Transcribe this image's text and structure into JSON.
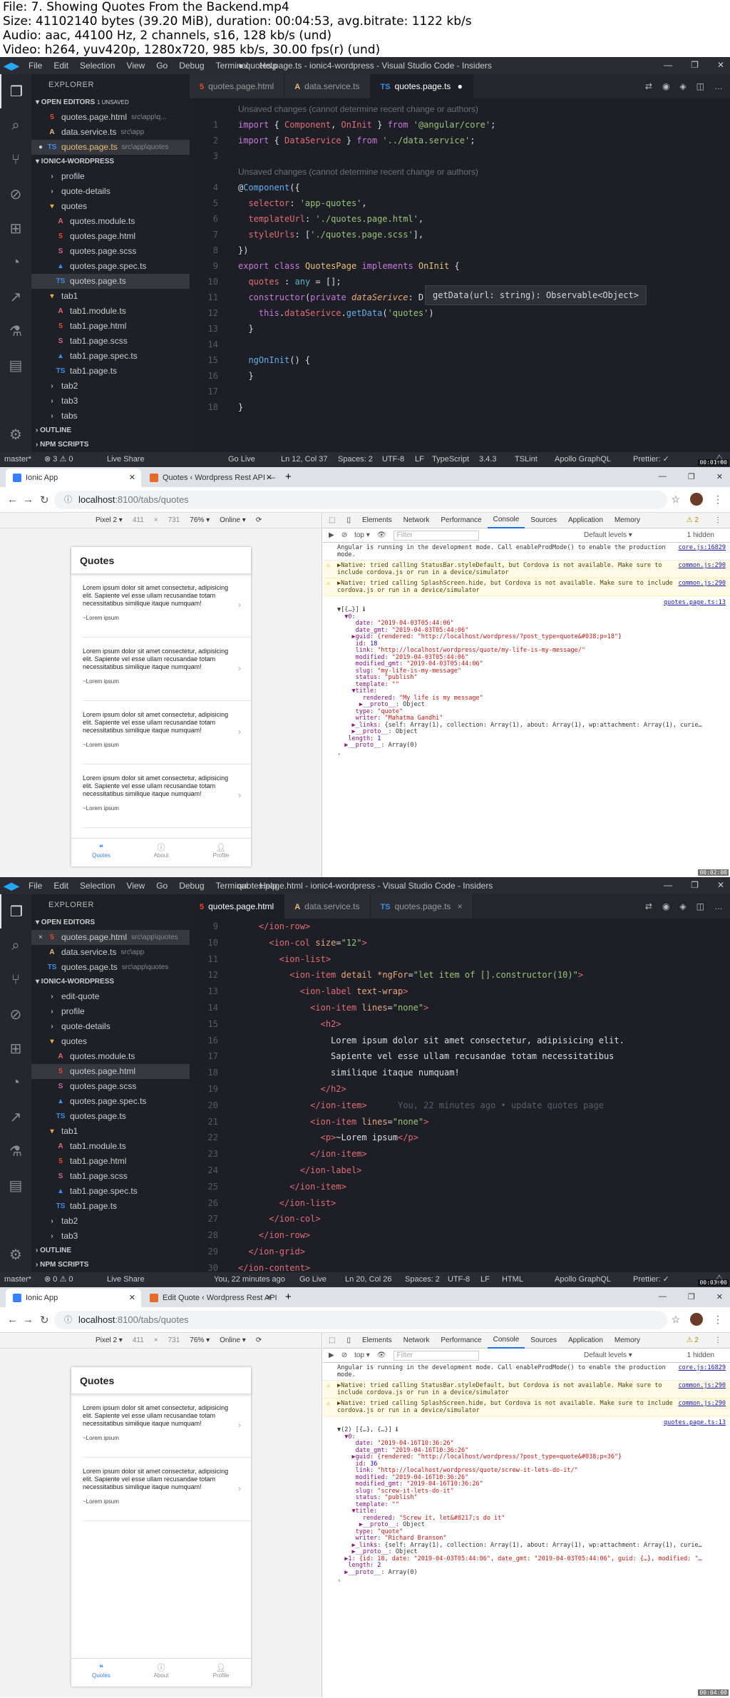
{
  "header": {
    "lines": [
      "File: 7. Showing Quotes From the Backend.mp4",
      "Size: 41102140 bytes (39.20 MiB), duration: 00:04:53, avg.bitrate: 1122 kb/s",
      "Audio: aac, 44100 Hz, 2 channels, s16, 128 kb/s (und)",
      "Video: h264, yuv420p, 1280x720, 985 kb/s, 30.00 fps(r) (und)"
    ]
  },
  "timestamps": [
    "00:01:00",
    "00:02:00",
    "00:03:00",
    "00:04:00"
  ],
  "vscode": {
    "menu": [
      "File",
      "Edit",
      "Selection",
      "View",
      "Go",
      "Debug",
      "Terminal",
      "Help"
    ],
    "explorer_title": "EXPLORER",
    "open_editors": "OPEN EDITORS",
    "unsaved": "1 UNSAVED",
    "project": "IONIC4-WORDPRESS",
    "outline": "OUTLINE",
    "npm_scripts": "NPM SCRIPTS",
    "frame1": {
      "window_title": "● quotes.page.ts - ionic4-wordpress - Visual Studio Code - Insiders",
      "tabs": [
        {
          "icon": "html-icon",
          "glyph": "5",
          "color": "#e44d26",
          "label": "quotes.page.html",
          "extra": ""
        },
        {
          "icon": "angular-icon",
          "glyph": "A",
          "color": "#e5c07b",
          "label": "data.service.ts",
          "extra": ""
        },
        {
          "icon": "ts-icon",
          "glyph": "TS",
          "color": "#3a8ee6",
          "label": "quotes.page.ts",
          "extra": "●"
        }
      ],
      "open_editors": [
        {
          "icon": "html-icon",
          "glyph": "5",
          "color": "#e44d26",
          "label": "quotes.page.html",
          "path": "src\\app\\q...",
          "mark": ""
        },
        {
          "icon": "angular-icon",
          "glyph": "A",
          "color": "#e5c07b",
          "label": "data.service.ts",
          "path": "src\\app",
          "mark": ""
        },
        {
          "icon": "ts-icon",
          "glyph": "TS",
          "color": "#3a8ee6",
          "label": "quotes.page.ts",
          "path": "src\\app\\quotes",
          "mark": "●"
        }
      ],
      "tree": [
        {
          "indent": 1,
          "icon": "chevron",
          "glyph": "›",
          "color": "#bbb",
          "label": "profile"
        },
        {
          "indent": 1,
          "icon": "chevron",
          "glyph": "›",
          "color": "#bbb",
          "label": "quote-details"
        },
        {
          "indent": 1,
          "icon": "folder-open",
          "glyph": "▾",
          "color": "#e8b04a",
          "label": "quotes"
        },
        {
          "indent": 2,
          "icon": "angular-icon",
          "glyph": "A",
          "color": "#e06c75",
          "label": "quotes.module.ts"
        },
        {
          "indent": 2,
          "icon": "html-icon",
          "glyph": "5",
          "color": "#e44d26",
          "label": "quotes.page.html"
        },
        {
          "indent": 2,
          "icon": "scss-icon",
          "glyph": "S",
          "color": "#cd6799",
          "label": "quotes.page.scss"
        },
        {
          "indent": 2,
          "icon": "spec-icon",
          "glyph": "▲",
          "color": "#3a8ee6",
          "label": "quotes.page.spec.ts"
        },
        {
          "indent": 2,
          "icon": "ts-icon",
          "glyph": "TS",
          "color": "#3a8ee6",
          "label": "quotes.page.ts",
          "sel": true
        },
        {
          "indent": 1,
          "icon": "folder-open",
          "glyph": "▾",
          "color": "#e8b04a",
          "label": "tab1"
        },
        {
          "indent": 2,
          "icon": "angular-icon",
          "glyph": "A",
          "color": "#e06c75",
          "label": "tab1.module.ts"
        },
        {
          "indent": 2,
          "icon": "html-icon",
          "glyph": "5",
          "color": "#e44d26",
          "label": "tab1.page.html"
        },
        {
          "indent": 2,
          "icon": "scss-icon",
          "glyph": "S",
          "color": "#cd6799",
          "label": "tab1.page.scss"
        },
        {
          "indent": 2,
          "icon": "spec-icon",
          "glyph": "▲",
          "color": "#3a8ee6",
          "label": "tab1.page.spec.ts"
        },
        {
          "indent": 2,
          "icon": "ts-icon",
          "glyph": "TS",
          "color": "#3a8ee6",
          "label": "tab1.page.ts"
        },
        {
          "indent": 1,
          "icon": "chevron",
          "glyph": "›",
          "color": "#bbb",
          "label": "tab2"
        },
        {
          "indent": 1,
          "icon": "chevron",
          "glyph": "›",
          "color": "#bbb",
          "label": "tab3"
        },
        {
          "indent": 1,
          "icon": "chevron",
          "glyph": "›",
          "color": "#bbb",
          "label": "tabs"
        }
      ],
      "lens_top": "Unsaved changes (cannot determine recent change or authors)",
      "lens_mid": "Unsaved changes (cannot determine recent change or authors)",
      "lines": [
        {
          "n": "1",
          "html": "<span class=\"k\">import</span> <span class=\"w\">{ </span><span class=\"c\">Component</span><span class=\"w\">, </span><span class=\"c\">OnInit</span><span class=\"w\"> } </span><span class=\"k\">from</span> <span class=\"g\">'@angular/core'</span><span class=\"w\">;</span>"
        },
        {
          "n": "2",
          "html": "<span class=\"k\">import</span> <span class=\"w\">{ </span><span class=\"c\">DataService</span><span class=\"w\"> } </span><span class=\"k\">from</span> <span class=\"g\">'../data.service'</span><span class=\"w\">;</span>"
        },
        {
          "n": "3",
          "html": ""
        },
        {
          "n": "4",
          "html": "<span class=\"w\">@</span><span class=\"b\">Component</span><span class=\"w\">({</span>"
        },
        {
          "n": "5",
          "html": "  <span class=\"c\">selector</span><span class=\"w\">: </span><span class=\"g\">'app-quotes'</span><span class=\"w\">,</span>"
        },
        {
          "n": "6",
          "html": "  <span class=\"c\">templateUrl</span><span class=\"w\">: </span><span class=\"g\">'./quotes.page.html'</span><span class=\"w\">,</span>"
        },
        {
          "n": "7",
          "html": "  <span class=\"c\">styleUrls</span><span class=\"w\">: [</span><span class=\"g\">'./quotes.page.scss'</span><span class=\"w\">],</span>"
        },
        {
          "n": "8",
          "html": "<span class=\"w\">})</span>"
        },
        {
          "n": "9",
          "html": "<span class=\"k\">export</span> <span class=\"k\">class</span> <span class=\"y\">QuotesPage</span> <span class=\"k\">implements</span> <span class=\"y\">OnInit</span> <span class=\"w\">{</span>"
        },
        {
          "n": "10",
          "html": "  <span class=\"c\">quotes</span> <span class=\"w\">: </span><span class=\"t\">any</span> <span class=\"w\">= [];</span>"
        },
        {
          "n": "11",
          "html": "  <span class=\"k\">constructor</span><span class=\"w\">(</span><span class=\"k\">private</span> <span class=\"o\"><i>dataSerivce</i></span><span class=\"w\">: D</span>"
        },
        {
          "n": "12",
          "html": "    <span class=\"k\">this</span><span class=\"w\">.</span><span class=\"c\">dataSerivce</span><span class=\"w\">.</span><span class=\"b\">getData</span><span class=\"w\">(</span><span class=\"g\">'quotes'</span><span class=\"w\">)</span>"
        },
        {
          "n": "13",
          "html": "  <span class=\"w\">}</span>"
        },
        {
          "n": "14",
          "html": ""
        },
        {
          "n": "15",
          "html": "  <span class=\"b\">ngOnInit</span><span class=\"w\">() {</span>"
        },
        {
          "n": "16",
          "html": "  <span class=\"w\">}</span>"
        },
        {
          "n": "17",
          "html": ""
        },
        {
          "n": "18",
          "html": "<span class=\"w\">}</span>"
        }
      ],
      "hover": "getData(url: string): Observable<Object>",
      "status": {
        "branch": "master*",
        "errors": "⊗ 3 ⚠ 0",
        "live_share": "Live Share",
        "go_live": "Go Live",
        "position": "Ln 12, Col 37",
        "spaces": "Spaces: 2",
        "encoding": "UTF-8",
        "eol": "LF",
        "lang": "TypeScript",
        "version": "3.4.3",
        "tslint": "TSLint",
        "apollo": "Apollo GraphQL",
        "prettier": "Prettier: ✓"
      }
    },
    "frame3": {
      "window_title": "quotes.page.html - ionic4-wordpress - Visual Studio Code - Insiders",
      "tabs": [
        {
          "icon": "html-icon",
          "glyph": "5",
          "color": "#e44d26",
          "label": "quotes.page.html",
          "extra": ""
        },
        {
          "icon": "angular-icon",
          "glyph": "A",
          "color": "#e5c07b",
          "label": "data.service.ts",
          "extra": ""
        },
        {
          "icon": "ts-icon",
          "glyph": "TS",
          "color": "#3a8ee6",
          "label": "quotes.page.ts",
          "extra": "×"
        }
      ],
      "open_editors": [
        {
          "icon": "html-icon",
          "glyph": "5",
          "color": "#e44d26",
          "label": "quotes.page.html",
          "path": "src\\app\\quotes",
          "mark": "×"
        },
        {
          "icon": "angular-icon",
          "glyph": "A",
          "color": "#e5c07b",
          "label": "data.service.ts",
          "path": "src\\app",
          "mark": ""
        },
        {
          "icon": "ts-icon",
          "glyph": "TS",
          "color": "#3a8ee6",
          "label": "quotes.page.ts",
          "path": "src\\app\\quotes",
          "mark": ""
        }
      ],
      "tree": [
        {
          "indent": 1,
          "icon": "chevron",
          "glyph": "›",
          "color": "#bbb",
          "label": "edit-quote"
        },
        {
          "indent": 1,
          "icon": "chevron",
          "glyph": "›",
          "color": "#bbb",
          "label": "profile"
        },
        {
          "indent": 1,
          "icon": "chevron",
          "glyph": "›",
          "color": "#bbb",
          "label": "quote-details"
        },
        {
          "indent": 1,
          "icon": "folder-open",
          "glyph": "▾",
          "color": "#e8b04a",
          "label": "quotes"
        },
        {
          "indent": 2,
          "icon": "angular-icon",
          "glyph": "A",
          "color": "#e06c75",
          "label": "quotes.module.ts"
        },
        {
          "indent": 2,
          "icon": "html-icon",
          "glyph": "5",
          "color": "#e44d26",
          "label": "quotes.page.html",
          "sel": true
        },
        {
          "indent": 2,
          "icon": "scss-icon",
          "glyph": "S",
          "color": "#cd6799",
          "label": "quotes.page.scss"
        },
        {
          "indent": 2,
          "icon": "spec-icon",
          "glyph": "▲",
          "color": "#3a8ee6",
          "label": "quotes.page.spec.ts"
        },
        {
          "indent": 2,
          "icon": "ts-icon",
          "glyph": "TS",
          "color": "#3a8ee6",
          "label": "quotes.page.ts"
        },
        {
          "indent": 1,
          "icon": "folder-open",
          "glyph": "▾",
          "color": "#e8b04a",
          "label": "tab1"
        },
        {
          "indent": 2,
          "icon": "angular-icon",
          "glyph": "A",
          "color": "#e06c75",
          "label": "tab1.module.ts"
        },
        {
          "indent": 2,
          "icon": "html-icon",
          "glyph": "5",
          "color": "#e44d26",
          "label": "tab1.page.html"
        },
        {
          "indent": 2,
          "icon": "scss-icon",
          "glyph": "S",
          "color": "#cd6799",
          "label": "tab1.page.scss"
        },
        {
          "indent": 2,
          "icon": "spec-icon",
          "glyph": "▲",
          "color": "#3a8ee6",
          "label": "tab1.page.spec.ts"
        },
        {
          "indent": 2,
          "icon": "ts-icon",
          "glyph": "TS",
          "color": "#3a8ee6",
          "label": "tab1.page.ts"
        },
        {
          "indent": 1,
          "icon": "chevron",
          "glyph": "›",
          "color": "#bbb",
          "label": "tab2"
        },
        {
          "indent": 1,
          "icon": "chevron",
          "glyph": "›",
          "color": "#bbb",
          "label": "tab3"
        }
      ],
      "lines": [
        {
          "n": "9",
          "html": "    <span class=\"c\">&lt;/ion-row&gt;</span>"
        },
        {
          "n": "10",
          "html": "      <span class=\"c\">&lt;ion-col</span> <span class=\"o\">size</span><span class=\"w\">=</span><span class=\"g\">\"12\"</span><span class=\"c\">&gt;</span>"
        },
        {
          "n": "11",
          "html": "        <span class=\"c\">&lt;ion-list&gt;</span>"
        },
        {
          "n": "12",
          "html": "          <span class=\"c\">&lt;ion-item</span> <span class=\"o\">detail *ngFor</span><span class=\"w\">=</span><span class=\"g\">\"let item of [].constructor(10)\"</span><span class=\"c\">&gt;</span>"
        },
        {
          "n": "13",
          "html": "            <span class=\"c\">&lt;ion-label</span> <span class=\"o\">text-wrap</span><span class=\"c\">&gt;</span>"
        },
        {
          "n": "14",
          "html": "              <span class=\"c\">&lt;ion-item</span> <span class=\"o\">lines</span><span class=\"w\">=</span><span class=\"g\">\"none\"</span><span class=\"c\">&gt;</span>"
        },
        {
          "n": "15",
          "html": "                <span class=\"c\">&lt;h2&gt;</span>"
        },
        {
          "n": "16",
          "html": "                  <span class=\"w\">Lorem ipsum dolor sit amet consectetur, adipisicing elit.</span>"
        },
        {
          "n": "17",
          "html": "                  <span class=\"w\">Sapiente vel esse ullam recusandae totam necessitatibus</span>"
        },
        {
          "n": "18",
          "html": "                  <span class=\"w\">similique itaque numquam!</span>"
        },
        {
          "n": "19",
          "html": "                <span class=\"c\">&lt;/h2&gt;</span>"
        },
        {
          "n": "20",
          "html": "              <span class=\"c\">&lt;/ion-item&gt;</span>      <span style=\"color:#5b5d66\">You, 22 minutes ago • update quotes page</span>"
        },
        {
          "n": "21",
          "html": "              <span class=\"c\">&lt;ion-item</span> <span class=\"o\">lines</span><span class=\"w\">=</span><span class=\"g\">\"none\"</span><span class=\"c\">&gt;</span>"
        },
        {
          "n": "22",
          "html": "                <span class=\"c\">&lt;p&gt;</span><span class=\"w\">~Lorem ipsum</span><span class=\"c\">&lt;/p&gt;</span>"
        },
        {
          "n": "23",
          "html": "              <span class=\"c\">&lt;/ion-item&gt;</span>"
        },
        {
          "n": "24",
          "html": "            <span class=\"c\">&lt;/ion-label&gt;</span>"
        },
        {
          "n": "25",
          "html": "          <span class=\"c\">&lt;/ion-item&gt;</span>"
        },
        {
          "n": "26",
          "html": "        <span class=\"c\">&lt;/ion-list&gt;</span>"
        },
        {
          "n": "27",
          "html": "      <span class=\"c\">&lt;/ion-col&gt;</span>"
        },
        {
          "n": "28",
          "html": "    <span class=\"c\">&lt;/ion-row&gt;</span>"
        },
        {
          "n": "29",
          "html": "  <span class=\"c\">&lt;/ion-grid&gt;</span>"
        },
        {
          "n": "30",
          "html": "<span class=\"c\">&lt;/ion-content&gt;</span>"
        }
      ],
      "status": {
        "branch": "master*",
        "errors": "⊗ 0 ⚠ 0",
        "live_share": "Live Share",
        "blame": "You, 22 minutes ago",
        "go_live": "Go Live",
        "position": "Ln 20, Col 26",
        "spaces": "Spaces: 2",
        "encoding": "UTF-8",
        "eol": "LF",
        "lang": "HTML",
        "apollo": "Apollo GraphQL",
        "prettier": "Prettier: ✓"
      }
    }
  },
  "browser": {
    "url_host": "localhost",
    "url_path": ":8100/tabs/quotes",
    "devbar": {
      "device": "Pixel 2 ▾",
      "w": "411",
      "h": "731",
      "zoom": "76% ▾",
      "net": "Online ▾"
    },
    "devtools_tabs": [
      "Elements",
      "Network",
      "Performance",
      "Console",
      "Sources",
      "Application",
      "Memory"
    ],
    "devtools_errors": "⚠ 2",
    "context": "top",
    "filter_placeholder": "Filter",
    "levels": "Default levels ▾",
    "hidden": "1 hidden",
    "phone_title": "Quotes",
    "quote_text": "Lorem ipsum dolor sit amet consectetur, adipisicing elit. Sapiente vel esse ullam recusandae totam necessitatibus similique itaque numquam!",
    "quote_author": "~Lorem ipsum",
    "tabbar": [
      "Quotes",
      "About",
      "Profile"
    ],
    "msg_dev": "Angular is running in the development mode. Call enableProdMode() to enable the production mode.",
    "src_core": "core.js:16829",
    "warn1": "▶Native: tried calling StatusBar.styleDefault, but Cordova is not available. Make sure to include cordova.js or run in a device/simulator",
    "warn2": "▶Native: tried calling SplashScreen.hide, but Cordova is not available. Make sure to include cordova.js or run in a device/simulator",
    "src_common": "common.js:290",
    "src_quotes": "quotes.page.ts:13",
    "frame2": {
      "tab1": "Ionic App",
      "tab2": "Quotes ‹ Wordpress Rest API —",
      "tree": [
        "▼[{…}] ℹ",
        "  ▼0:",
        "     date: \"2019-04-03T05:44:06\"",
        "     date_gmt: \"2019-04-03T05:44:06\"",
        "    ▶guid: {rendered: \"http://localhost/wordpress/?post_type=quote&#038;p=18\"}",
        "     id: 18",
        "     link: \"http://localhost/wordpress/quote/my-life-is-my-message/\"",
        "     modified: \"2019-04-03T05:44:06\"",
        "     modified_gmt: \"2019-04-03T05:44:06\"",
        "     slug: \"my-life-is-my-message\"",
        "     status: \"publish\"",
        "     template: \"\"",
        "    ▼title:",
        "       rendered: \"My life is my message\"",
        "      ▶__proto__: Object",
        "     type: \"quote\"",
        "     writer: \"Mahatma Gandhi\"",
        "    ▶_links: {self: Array(1), collection: Array(1), about: Array(1), wp:attachment: Array(1), curie…",
        "    ▶__proto__: Object",
        "   length: 1",
        "  ▶__proto__: Array(0)"
      ]
    },
    "frame4": {
      "tab1": "Ionic App",
      "tab2": "Edit Quote ‹ Wordpress Rest API",
      "tree": [
        "▼(2) [{…}, {…}] ℹ",
        "  ▼0:",
        "     date: \"2019-04-16T10:36:26\"",
        "     date_gmt: \"2019-04-16T10:36:26\"",
        "    ▶guid: {rendered: \"http://localhost/wordpress/?post_type=quote&#038;p=36\"}",
        "     id: 36",
        "     link: \"http://localhost/wordpress/quote/screw-it-lets-do-it/\"",
        "     modified: \"2019-04-16T10:36:26\"",
        "     modified_gmt: \"2019-04-16T10:36:26\"",
        "     slug: \"screw-it-lets-do-it\"",
        "     status: \"publish\"",
        "     template: \"\"",
        "    ▼title:",
        "       rendered: \"Screw it, let&#8217;s do it\"",
        "      ▶__proto__: Object",
        "     type: \"quote\"",
        "     writer: \"Richard Branson\"",
        "    ▶_links: {self: Array(1), collection: Array(1), about: Array(1), wp:attachment: Array(1), curie…",
        "    ▶__proto__: Object",
        "  ▶1: {id: 18, date: \"2019-04-03T05:44:06\", date_gmt: \"2019-04-03T05:44:06\", guid: {…}, modified: \"…",
        "   length: 2",
        "  ▶__proto__: Array(0)"
      ]
    }
  }
}
